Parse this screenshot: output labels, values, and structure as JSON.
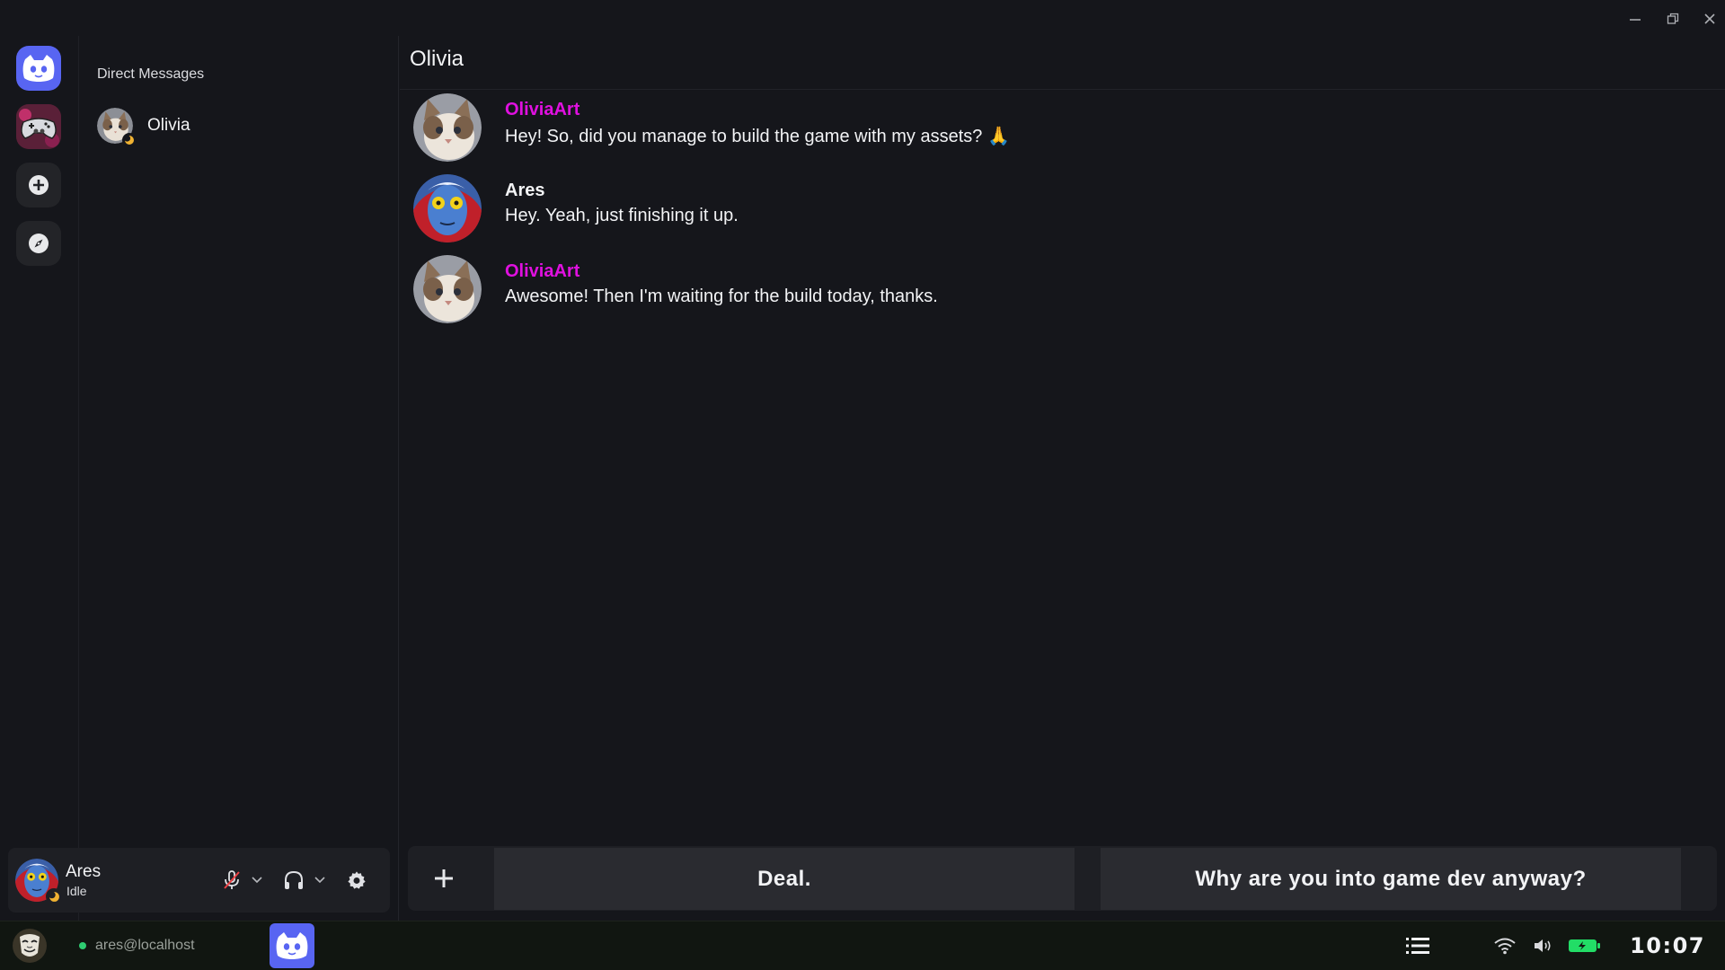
{
  "window": {
    "controls": [
      "minimize-icon",
      "restore-icon",
      "close-icon"
    ]
  },
  "rail": {
    "items": [
      "discord-home-icon",
      "server-gamepad-icon",
      "add-server-icon",
      "explore-icon"
    ]
  },
  "dm_panel": {
    "header": "Direct Messages",
    "items": [
      {
        "name": "Olivia",
        "status": "idle"
      }
    ]
  },
  "user": {
    "name": "Ares",
    "status": "Idle"
  },
  "chat": {
    "title": "Olivia",
    "messages": [
      {
        "author": "OliviaArt",
        "author_color": "#e010e0",
        "text": "Hey! So, did you manage to build the game with my assets? 🙏",
        "avatar": "cat"
      },
      {
        "author": "Ares",
        "author_color": "#f2f3f5",
        "text": "Hey. Yeah, just finishing it up.",
        "avatar": "pop-art"
      },
      {
        "author": "OliviaArt",
        "author_color": "#e010e0",
        "text": "Awesome! Then I'm waiting for the build today, thanks.",
        "avatar": "cat"
      }
    ]
  },
  "reply": {
    "choices": [
      "Deal.",
      "Why are you into game dev anyway?"
    ]
  },
  "taskbar": {
    "user_host": "ares@localhost",
    "clock": "10:07"
  },
  "colors": {
    "accent": "#5865f2",
    "mention_pink": "#e010e0",
    "idle": "#f0b232",
    "online_green": "#2ecc71",
    "battery": "#22dd66"
  }
}
